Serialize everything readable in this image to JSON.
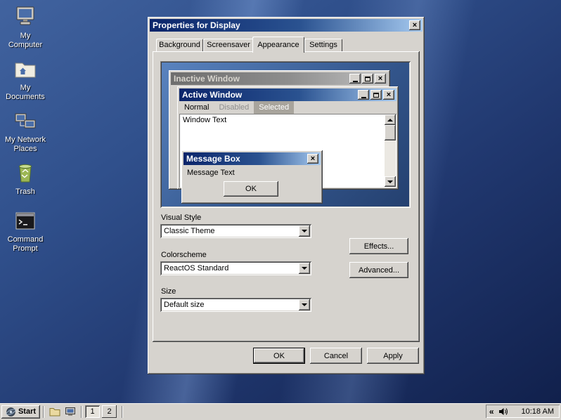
{
  "colors": {
    "active_titlebar_left": "#0a246a",
    "active_titlebar_right": "#a6caf0",
    "inactive_titlebar": "#8e8e8e",
    "window_face": "#d6d3ce",
    "desktop_blue": "#30508c",
    "menu_highlight": "#a8a49c"
  },
  "glyphs": {
    "close": "×",
    "tray_chevron": "«"
  },
  "desktop": {
    "icons": [
      {
        "label": "My Computer"
      },
      {
        "label": "My Documents"
      },
      {
        "label": "My Network Places"
      },
      {
        "label": "Trash"
      },
      {
        "label": "Command Prompt"
      }
    ]
  },
  "dialog": {
    "title": "Properties for Display",
    "tabs": [
      "Background",
      "Screensaver",
      "Appearance",
      "Settings"
    ],
    "active_tab": "Appearance",
    "preview": {
      "inactive_window_title": "Inactive Window",
      "active_window_title": "Active Window",
      "menu": [
        "Normal",
        "Disabled",
        "Selected"
      ],
      "window_text": "Window Text",
      "message_box": {
        "title": "Message Box",
        "text": "Message Text",
        "ok_label": "OK"
      }
    },
    "fields": {
      "visual_style": {
        "label": "Visual Style",
        "value": "Classic Theme"
      },
      "colorscheme": {
        "label": "Colorscheme",
        "value": "ReactOS Standard"
      },
      "size": {
        "label": "Size",
        "value": "Default size"
      }
    },
    "buttons": {
      "effects": "Effects...",
      "advanced": "Advanced...",
      "ok": "OK",
      "cancel": "Cancel",
      "apply": "Apply"
    }
  },
  "taskbar": {
    "start_label": "Start",
    "pager_buttons": [
      "1",
      "2"
    ],
    "clock": "10:18 AM"
  }
}
